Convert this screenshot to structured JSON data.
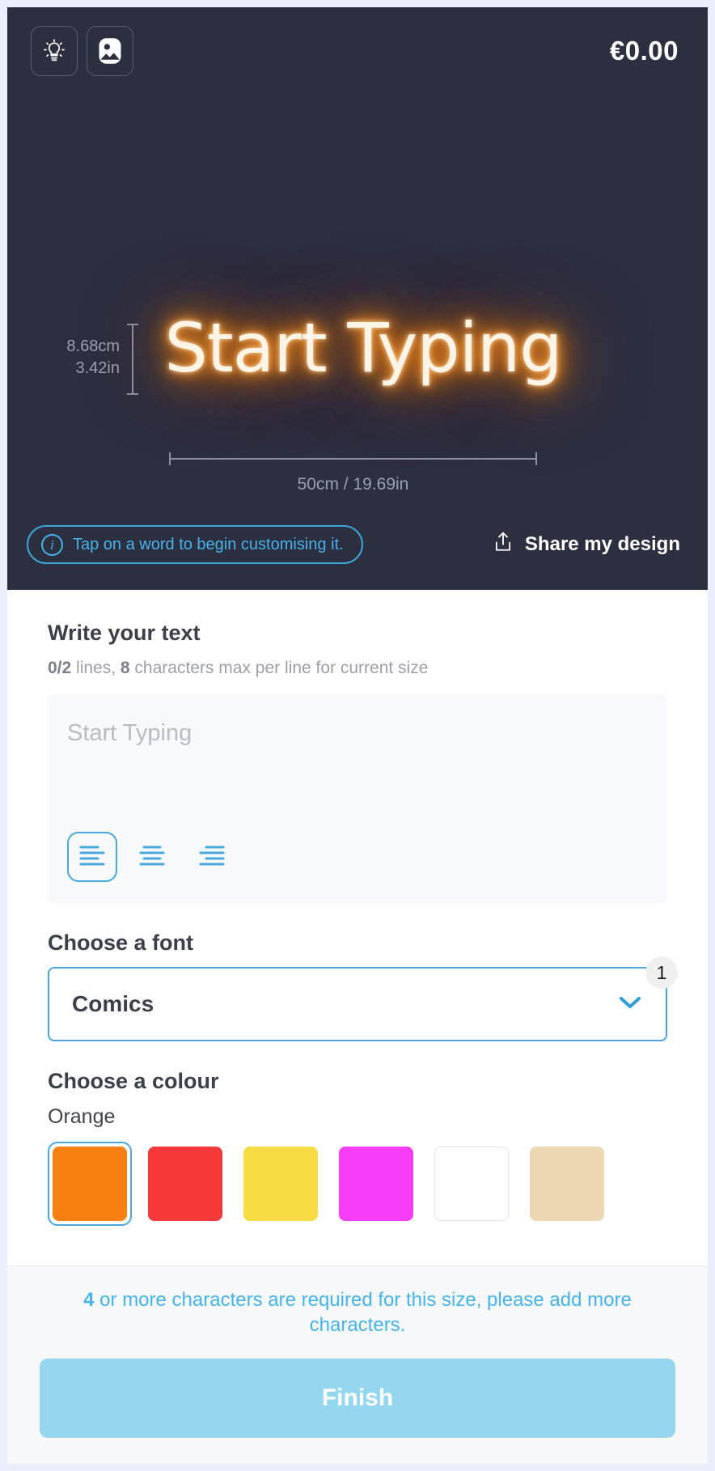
{
  "preview": {
    "toolbar": {
      "lightbulb_icon": "lightbulb-icon",
      "image_icon": "image-icon",
      "price": "€0.00"
    },
    "sign": {
      "text": "Start Typing",
      "glow_color": "#ff8c1a",
      "height_cm": "8.68cm",
      "height_in": "3.42in",
      "width_label": "50cm / 19.69in"
    },
    "hint": {
      "icon": "info-icon",
      "text": "Tap on a word to begin customising it."
    },
    "share": {
      "icon": "share-icon",
      "label": "Share my design"
    },
    "background_color": "#2b2f40"
  },
  "form": {
    "text_section": {
      "heading": "Write your text",
      "meta_lines": "0/2",
      "meta_mid": " lines, ",
      "meta_chars": "8",
      "meta_tail": " characters max per line for current size",
      "placeholder": "Start Typing",
      "value": "",
      "alignments": [
        {
          "name": "align-left",
          "selected": true
        },
        {
          "name": "align-center",
          "selected": false
        },
        {
          "name": "align-right",
          "selected": false
        }
      ]
    },
    "font_section": {
      "heading": "Choose a font",
      "selected": "Comics",
      "badge": "1",
      "chevron_icon": "chevron-down-icon"
    },
    "colour_section": {
      "heading": "Choose a colour",
      "selected_name": "Orange",
      "swatches": [
        {
          "name": "Orange",
          "hex": "#f98012",
          "selected": true
        },
        {
          "name": "Red",
          "hex": "#f5383a",
          "selected": false
        },
        {
          "name": "Yellow",
          "hex": "#f7dc44",
          "selected": false
        },
        {
          "name": "Pink",
          "hex": "#f73df7",
          "selected": false
        },
        {
          "name": "White",
          "hex": "#ffffff",
          "selected": false
        },
        {
          "name": "Warm White",
          "hex": "#ecd9b3",
          "selected": false
        }
      ]
    }
  },
  "footer": {
    "warning_count": "4",
    "warning_text": " or more characters are required for this size, please add more characters.",
    "finish_label": "Finish",
    "finish_color": "#95d7ef"
  }
}
